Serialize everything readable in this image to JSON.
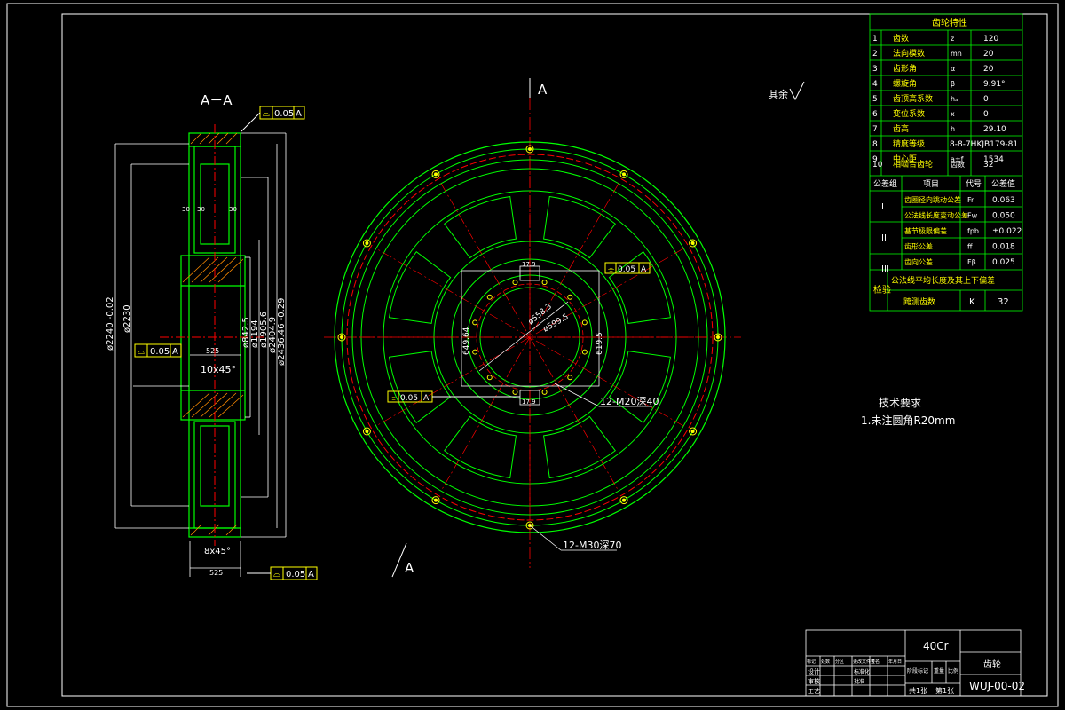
{
  "colors": {
    "background": "#000000",
    "frame": "#ffffff",
    "part": "#00ff00",
    "centerline": "#ff0000",
    "dimension": "#ffffff",
    "text": "#ffff00"
  },
  "section": {
    "label": "A－A",
    "flatness_top": "0.05",
    "flatness_mid": "0.05",
    "flatness_bottom": "0.05",
    "datum": "A",
    "chamfer_top": "10x45°",
    "chamfer_bottom": "8x45°",
    "width_top": "525",
    "width_bottom": "525",
    "dim_od1": "ø2240 -0.02",
    "dim_od2": "ø2230",
    "dim_bore1": "ø842.5",
    "dim_bore2": "ø1194",
    "dim_bore3": "ø1905.6",
    "dim_od3": "ø2404.9",
    "dim_od4": "ø2436.46 -0.29",
    "small_dims": [
      "30",
      "30",
      "30"
    ]
  },
  "front_view": {
    "section_mark_top": "A",
    "section_mark_bottom": "A",
    "hole_note_1": "12-M20深40",
    "hole_note_2": "12-M30深70",
    "dim_d1": "ø558.3",
    "dim_d2": "ø599.5",
    "dim_h1": "649.64",
    "dim_h2": "619.5",
    "dim_top": "17.9",
    "dim_bot": "17.9",
    "tol_top": "0.05",
    "tol_bot": "0.05",
    "datum": "A"
  },
  "roughness_note": "其余",
  "gear_table": {
    "title": "齿轮特性",
    "rows": [
      {
        "no": "1",
        "name": "齿数",
        "sym": "z",
        "val": "120"
      },
      {
        "no": "2",
        "name": "法向模数",
        "sym": "mn",
        "val": "20"
      },
      {
        "no": "3",
        "name": "齿形角",
        "sym": "α",
        "val": "20"
      },
      {
        "no": "4",
        "name": "螺旋角",
        "sym": "β",
        "val": "9.91°"
      },
      {
        "no": "5",
        "name": "齿顶高系数",
        "sym": "hₐ",
        "val": "0"
      },
      {
        "no": "6",
        "name": "变位系数",
        "sym": "x",
        "val": "0"
      },
      {
        "no": "7",
        "name": "齿高",
        "sym": "h",
        "val": "29.10"
      },
      {
        "no": "8",
        "name": "精度等级",
        "sym": "",
        "val": "8-8-7HKJB179-81"
      },
      {
        "no": "9",
        "name": "中心距",
        "sym": "a±f",
        "val": "1534"
      },
      {
        "no": "10",
        "name": "相啮合齿轮",
        "sym": "齿数",
        "val": "32"
      }
    ],
    "tol_header": [
      "公差组",
      "项目",
      "代号",
      "公差值"
    ],
    "tol_rows": [
      {
        "grp": "I",
        "item": "齿圈径向跳动公差",
        "code": "Fr",
        "val": "0.063"
      },
      {
        "grp": "",
        "item": "公法线长度变动公差",
        "code": "Fw",
        "val": "0.050"
      },
      {
        "grp": "II",
        "item": "基节极限偏差",
        "code": "fpb",
        "val": "±0.022"
      },
      {
        "grp": "",
        "item": "齿形公差",
        "code": "ff",
        "val": "0.018"
      },
      {
        "grp": "III",
        "item": "齿向公差",
        "code": "Fβ",
        "val": "0.025"
      }
    ],
    "check_label": "检验",
    "check_item_1": "公法线平均长度及其上下偏差",
    "check_item_2": "跨测齿数",
    "check_sym": "K",
    "check_val": "32"
  },
  "tech_req": {
    "title": "技术要求",
    "item1": "1.未注圆角R20mm"
  },
  "title_block": {
    "material": "40Cr",
    "part_name": "齿轮",
    "drawing_no": "WUJ-00-02",
    "sheet_total": "共1张",
    "sheet_no": "第1张",
    "head_cells": [
      "标记",
      "处数",
      "分区",
      "更改文件号",
      "签名",
      "年月日"
    ],
    "row_labels": [
      "设计",
      "审核",
      "工艺"
    ],
    "mid_labels": [
      "标准化",
      "批准"
    ],
    "stage_labels": [
      "阶段标记",
      "重量",
      "比例"
    ]
  }
}
